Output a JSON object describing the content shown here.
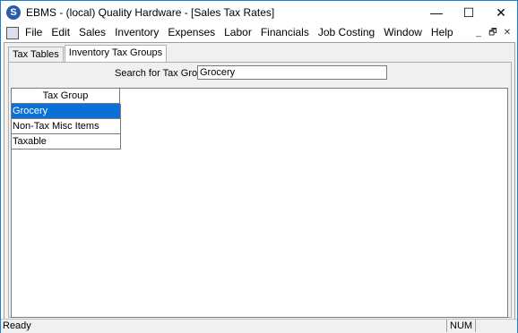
{
  "window": {
    "title": "EBMS - (local) Quality Hardware - [Sales Tax Rates]",
    "app_icon_glyph": "S",
    "minimize_glyph": "—",
    "maximize_glyph": "☐",
    "close_glyph": "✕"
  },
  "menu": {
    "items": [
      "File",
      "Edit",
      "Sales",
      "Inventory",
      "Expenses",
      "Labor",
      "Financials",
      "Job Costing",
      "Window",
      "Help"
    ],
    "mdi_minimize_glyph": "_",
    "mdi_restore_glyph": "🗗",
    "mdi_close_glyph": "✕"
  },
  "tabs": [
    {
      "label": "Tax Tables",
      "active": false
    },
    {
      "label": "Inventory Tax Groups",
      "active": true
    }
  ],
  "search": {
    "label": "Search for Tax Group",
    "value": "Grocery"
  },
  "grid": {
    "header": "Tax Group",
    "rows": [
      "Grocery",
      "Non-Tax Misc Items",
      "Taxable"
    ],
    "selected_index": 0
  },
  "status": {
    "text": "Ready",
    "num": "NUM"
  },
  "colors": {
    "selection": "#0a6fd6",
    "window_border": "#1883d7",
    "icon_bg": "#2a5caa"
  }
}
